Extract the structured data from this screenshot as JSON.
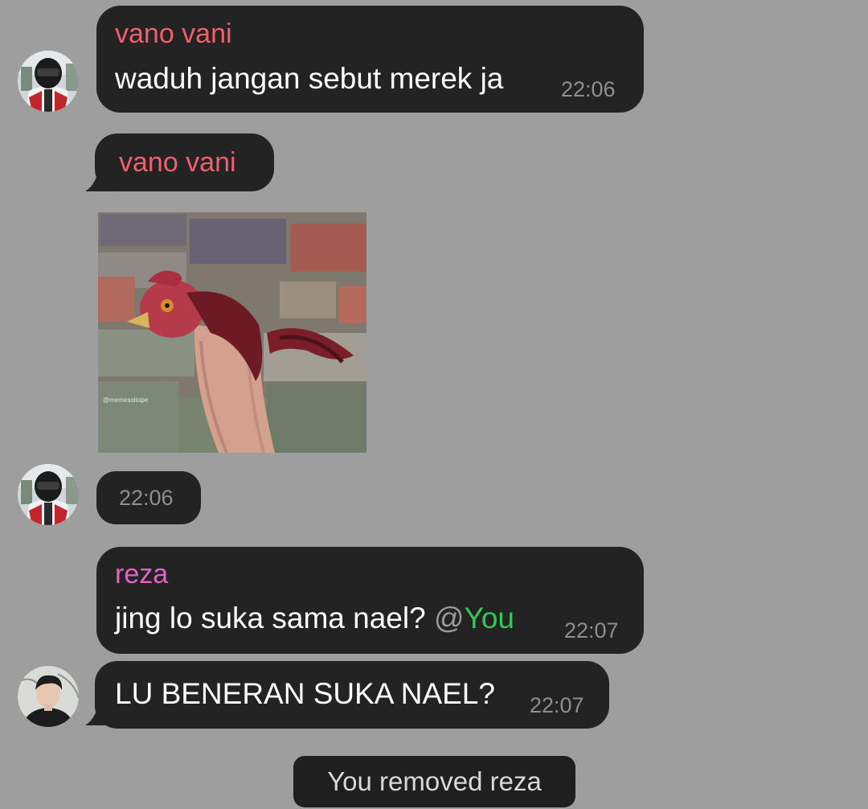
{
  "colors": {
    "background": "#9e9e9e",
    "bubble": "#232323",
    "sender_vano": "#f0606c",
    "sender_reza": "#e462c6",
    "mention_you": "#34c759",
    "mention_at": "#9a9a9a",
    "time": "#8e8e93"
  },
  "messages": [
    {
      "sender": "vano vani",
      "text": "waduh jangan sebut merek ja",
      "time": "22:06"
    },
    {
      "sender": "vano vani",
      "image": "chicken-meme-photo",
      "watermark": "@memesoitope",
      "time": "22:06"
    },
    {
      "sender": "reza",
      "text": "jing lo suka sama nael?",
      "mention_at": "@",
      "mention_name": "You",
      "time": "22:07"
    },
    {
      "text": "LU BENERAN SUKA NAEL?",
      "time": "22:07"
    }
  ],
  "service_message": "You removed reza"
}
